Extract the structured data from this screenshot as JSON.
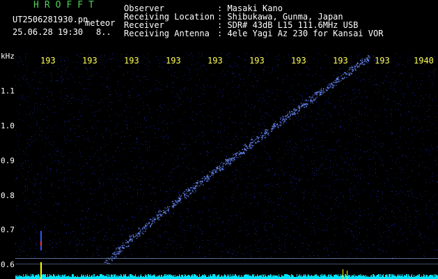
{
  "header": {
    "program": "HROFFT",
    "file_name": "UT2506281930.pn",
    "mode_label": "meteor",
    "date_time": "25.06.28 19:30",
    "count": "8..",
    "observer_label": "Observer",
    "observer_value": ": Masaki Kano",
    "location_label": "Receiving Location",
    "location_value": ": Shibukawa, Gunma, Japan",
    "receiver_label": "Receiver",
    "receiver_value": ": SDR# 43dB L15 111.6MHz USB",
    "antenna_label": "Receiving Antenna",
    "antenna_value": ": 4ele Yagi Az 230 for Kansai VOR"
  },
  "x_ticks": [
    "193",
    "193",
    "193",
    "193",
    "193",
    "193",
    "193",
    "193",
    "193",
    "1940"
  ],
  "y_axis": {
    "unit": "kHz",
    "labels": [
      "1.1",
      "1.0",
      "0.9",
      "0.8",
      "0.7",
      "0.6"
    ]
  },
  "colors": {
    "background": "#000000",
    "noise": "#1a2dbb",
    "trail": "#6a8cff",
    "tick_text": "#ffff55",
    "program_text": "#4bd15a",
    "baseline": "#00e5ff",
    "marker": "#ffff00"
  }
}
